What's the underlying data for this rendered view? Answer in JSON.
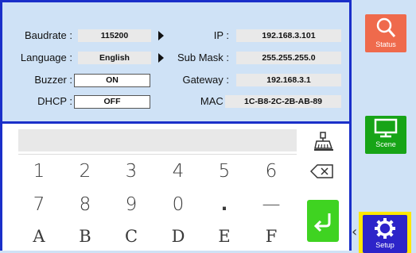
{
  "settings": {
    "baudrate_label": "Baudrate :",
    "baudrate_value": "115200",
    "language_label": "Language :",
    "language_value": "English",
    "buzzer_label": "Buzzer :",
    "buzzer_value": "ON",
    "dhcp_label": "DHCP :",
    "dhcp_value": "OFF",
    "ip_label": "IP :",
    "ip_value": "192.168.3.101",
    "submask_label": "Sub Mask :",
    "submask_value": "255.255.255.0",
    "gateway_label": "Gateway :",
    "gateway_value": "192.168.3.1",
    "mac_label": "MAC :",
    "mac_value": "1C-B8-2C-2B-AB-89"
  },
  "keypad": {
    "row1": [
      "1",
      "2",
      "3",
      "4",
      "5",
      "6"
    ],
    "row2": [
      "7",
      "8",
      "9",
      "0",
      ".",
      "—"
    ],
    "row3": [
      "A",
      "B",
      "C",
      "D",
      "E",
      "F"
    ]
  },
  "sidebar": {
    "status_label": "Status",
    "scene_label": "Scene",
    "setup_label": "Setup"
  },
  "colors": {
    "panel_border": "#1a2fc9",
    "status_button": "#ef6a4c",
    "scene_button": "#17a417",
    "setup_button": "#2d24c9",
    "setup_highlight": "#ffe800",
    "enter_button": "#3fd321"
  }
}
